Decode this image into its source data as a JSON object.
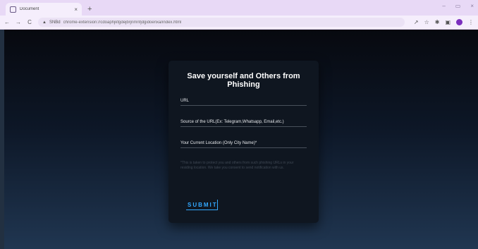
{
  "browser": {
    "tab": {
      "title": "Document",
      "close_glyph": "×"
    },
    "new_tab_glyph": "+",
    "window_controls": {
      "minimize": "‒",
      "restore": "▭",
      "close": "×"
    },
    "nav": {
      "back": "←",
      "forward": "→",
      "reload": "C"
    },
    "address": {
      "chip": "SNBd",
      "url": "chrome-extension://cdoaphjkfgdejbrjnmnfjdgidoenxa/index.html"
    }
  },
  "form": {
    "title": "Save yourself and Others from Phishing",
    "fields": [
      {
        "label": "URL"
      },
      {
        "label": "Source of the URL(Ex: Telegram,Whatsapp, Email,etc.)"
      },
      {
        "label": "Your Current Location (Only City Name)*"
      }
    ],
    "notice": "*This is taken to protect you and others from such phishing URLs in your residing location. We take you consent to send notification with us.",
    "submit_label": "SUBMIT"
  },
  "colors": {
    "accent": "#32a8ff",
    "card_bg": "#0f1620",
    "tabbar_bg": "#e8d9f6"
  }
}
